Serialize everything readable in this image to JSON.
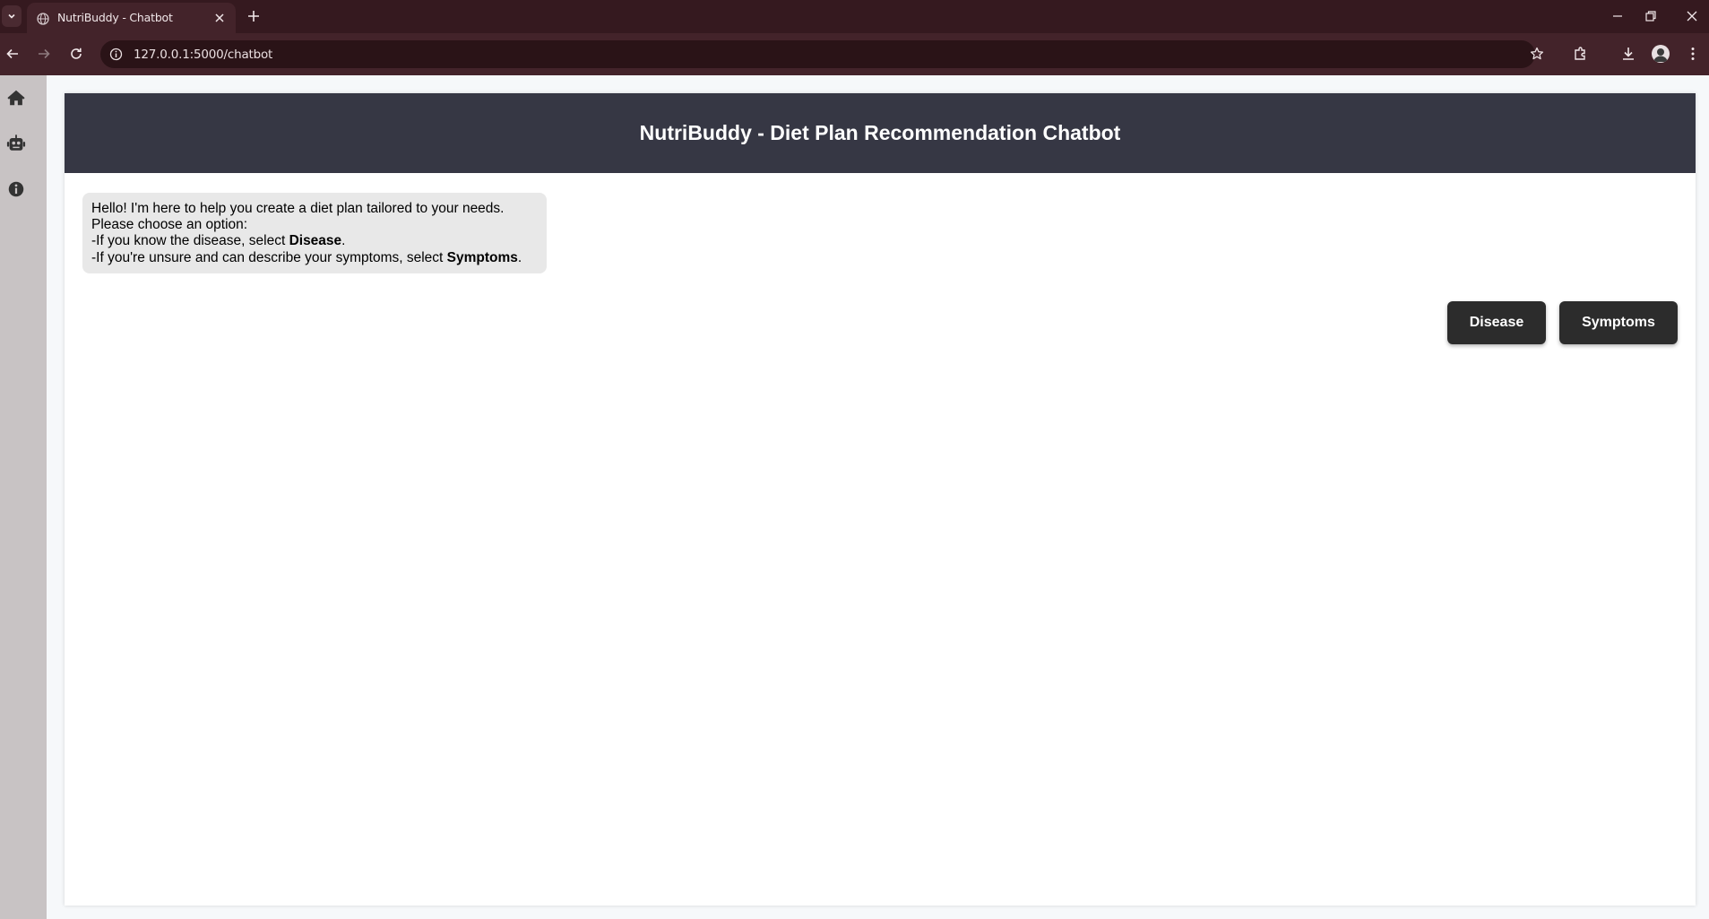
{
  "browser": {
    "tab_title": "NutriBuddy - Chatbot",
    "url": "127.0.0.1:5000/chatbot"
  },
  "sidebar": {
    "items": [
      {
        "icon": "home-icon"
      },
      {
        "icon": "robot-icon"
      },
      {
        "icon": "info-icon"
      }
    ]
  },
  "header": {
    "title": "NutriBuddy - Diet Plan Recommendation Chatbot"
  },
  "chat": {
    "bot_message": {
      "line1": "Hello! I'm here to help you create a diet plan tailored to your needs.",
      "line2": "Please choose an option:",
      "line3_prefix": "-If you know the disease, select ",
      "line3_bold": "Disease",
      "line3_suffix": ".",
      "line4_prefix": "-If you're unsure and can describe your symptoms, select ",
      "line4_bold": "Symptoms",
      "line4_suffix": "."
    },
    "options": {
      "disease_label": "Disease",
      "symptoms_label": "Symptoms"
    }
  },
  "colors": {
    "header_bg": "#363744",
    "button_bg": "#2c2c2c",
    "bubble_bg": "#e8e8e8",
    "sidebar_bg": "#c8c3c4",
    "browser_frame": "#35191f"
  }
}
